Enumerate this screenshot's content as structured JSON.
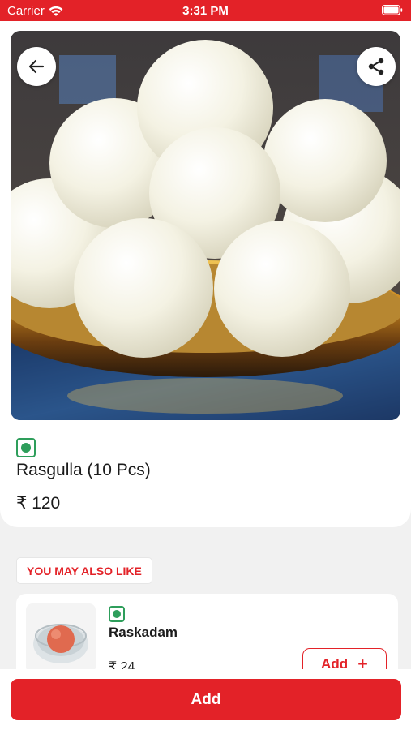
{
  "status_bar": {
    "carrier": "Carrier",
    "time": "3:31 PM"
  },
  "product": {
    "name": "Rasgulla (10 Pcs)",
    "price": "₹ 120",
    "veg": true
  },
  "recommendations": {
    "section_title": "YOU MAY ALSO LIKE",
    "items": [
      {
        "name": "Raskadam",
        "price": "₹ 24",
        "add_label": "Add",
        "add_icon": "+",
        "veg": true
      }
    ]
  },
  "footer": {
    "add_label": "Add"
  },
  "colors": {
    "accent": "#e32228",
    "veg_green": "#2e9e5b",
    "background": "#f1f1f1"
  },
  "icons": [
    "wifi-icon",
    "battery-icon",
    "back-arrow-icon",
    "share-icon",
    "veg-indicator-icon",
    "plus-icon"
  ]
}
